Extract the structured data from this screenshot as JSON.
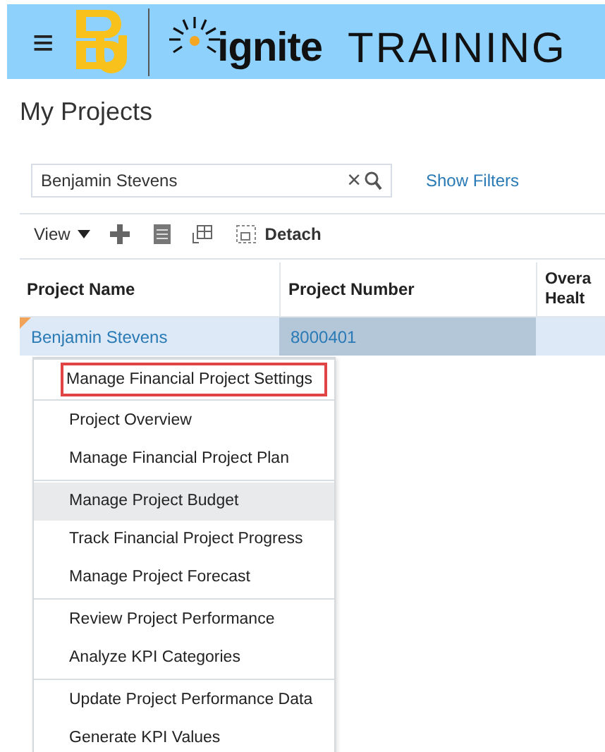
{
  "header": {
    "menu_glyph": "≡",
    "brand": "ignite",
    "title": "TRAINING"
  },
  "page_title": "My Projects",
  "search": {
    "value": "Benjamin Stevens",
    "clear_glyph": "×"
  },
  "show_filters": "Show Filters",
  "toolbar": {
    "view": "View",
    "detach": "Detach"
  },
  "table": {
    "columns": [
      {
        "lines": [
          "Project Name"
        ]
      },
      {
        "lines": [
          "Project Number"
        ]
      },
      {
        "lines": [
          "Overa",
          "Healt"
        ]
      }
    ],
    "rows": [
      {
        "selected": true,
        "cells": [
          "Benjamin Stevens",
          "8000401"
        ]
      }
    ]
  },
  "menu": {
    "groups": [
      [
        {
          "label": "Manage Financial Project Settings",
          "highlighted": false,
          "outlined": true
        }
      ],
      [
        {
          "label": "Project Overview",
          "highlighted": false,
          "outlined": false
        },
        {
          "label": "Manage Financial Project Plan",
          "highlighted": false,
          "outlined": false
        }
      ],
      [
        {
          "label": "Manage Project Budget",
          "highlighted": true,
          "outlined": false
        },
        {
          "label": "Track Financial Project Progress",
          "highlighted": false,
          "outlined": false
        },
        {
          "label": "Manage Project Forecast",
          "highlighted": false,
          "outlined": false
        }
      ],
      [
        {
          "label": "Review Project Performance",
          "highlighted": false,
          "outlined": false
        },
        {
          "label": "Analyze KPI Categories",
          "highlighted": false,
          "outlined": false
        }
      ],
      [
        {
          "label": "Update Project Performance Data",
          "highlighted": false,
          "outlined": false
        },
        {
          "label": "Generate KPI Values",
          "highlighted": false,
          "outlined": false
        }
      ]
    ]
  }
}
